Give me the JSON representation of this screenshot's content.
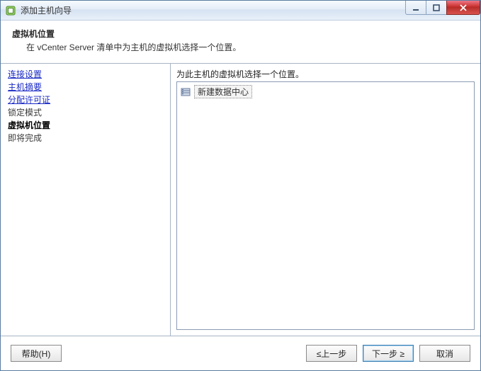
{
  "window": {
    "title": "添加主机向导"
  },
  "header": {
    "title": "虚拟机位置",
    "subtitle": "在 vCenter Server 清单中为主机的虚拟机选择一个位置。"
  },
  "sidebar": {
    "steps": [
      {
        "label": "连接设置",
        "kind": "link"
      },
      {
        "label": "主机摘要",
        "kind": "link"
      },
      {
        "label": "分配许可证",
        "kind": "link"
      },
      {
        "label": "锁定模式",
        "kind": "plain"
      },
      {
        "label": "虚拟机位置",
        "kind": "current"
      },
      {
        "label": "即将完成",
        "kind": "plain"
      }
    ]
  },
  "main": {
    "instruction": "为此主机的虚拟机选择一个位置。",
    "tree": {
      "items": [
        {
          "icon": "datacenter-icon",
          "label": "新建数据中心"
        }
      ]
    }
  },
  "footer": {
    "help": "帮助(H)",
    "back": "≤上一步",
    "next": "下一步 ≥",
    "cancel": "取消"
  }
}
